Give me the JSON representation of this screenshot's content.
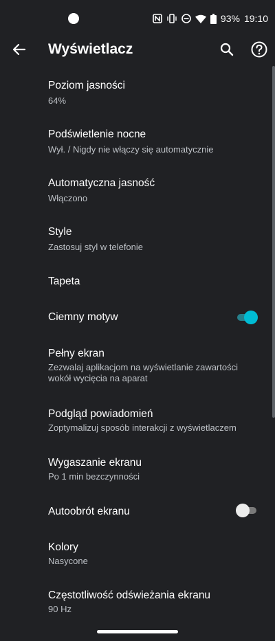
{
  "status": {
    "battery": "93%",
    "time": "19:10"
  },
  "header": {
    "title": "Wyświetlacz"
  },
  "settings": [
    {
      "label": "Poziom jasności",
      "sub": "64%"
    },
    {
      "label": "Podświetlenie nocne",
      "sub": "Wył. / Nigdy nie włączy się automatycznie"
    },
    {
      "label": "Automatyczna jasność",
      "sub": "Włączono"
    },
    {
      "label": "Style",
      "sub": "Zastosuj styl w telefonie"
    },
    {
      "label": "Tapeta"
    },
    {
      "label": "Ciemny motyw",
      "toggle": true
    },
    {
      "label": "Pełny ekran",
      "sub": "Zezwalaj aplikacjom na wyświetlanie zawartości wokół wycięcia na aparat"
    },
    {
      "label": "Podgląd powiadomień",
      "sub": "Zoptymalizuj sposób interakcji z wyświetlaczem"
    },
    {
      "label": "Wygaszanie ekranu",
      "sub": "Po 1 min bezczynności"
    },
    {
      "label": "Autoobrót ekranu",
      "toggle": false
    },
    {
      "label": "Kolory",
      "sub": "Nasycone"
    },
    {
      "label": "Częstotliwość odświeżania ekranu",
      "sub": "90 Hz"
    }
  ],
  "colors": {
    "accent": "#00bcd4",
    "accent_track": "#27808c",
    "off_thumb": "#ececec",
    "off_track": "#7a7a7a"
  }
}
